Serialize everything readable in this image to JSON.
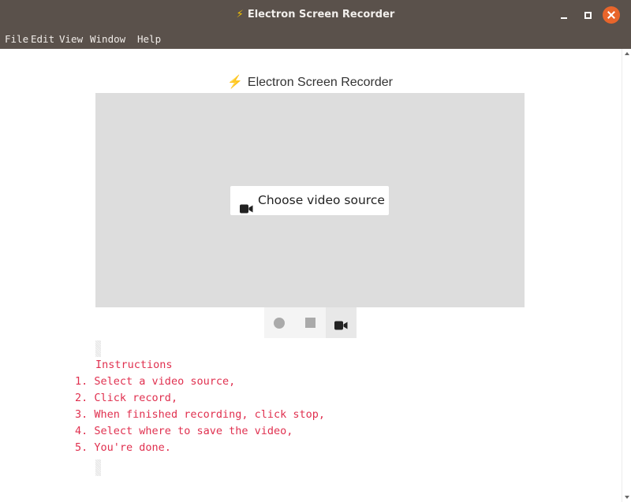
{
  "window": {
    "title": "Electron Screen Recorder",
    "title_icon": "⚡",
    "buttons": [
      "minimize",
      "maximize",
      "close"
    ]
  },
  "menu": [
    "File",
    "Edit",
    "View",
    "Window",
    "Help"
  ],
  "app": {
    "heading_icon": "⚡",
    "heading": "Electron Screen Recorder",
    "choose_source_label": "Choose video source",
    "controls": {
      "record_icon": "record-icon",
      "stop_icon": "stop-icon",
      "camera_icon": "video-camera-icon"
    }
  },
  "instructions": {
    "title": "Instructions",
    "steps": [
      {
        "num": "1.",
        "text": "Select a video source,"
      },
      {
        "num": "2.",
        "text": "Click record,"
      },
      {
        "num": "3.",
        "text": "When finished recording, click stop,"
      },
      {
        "num": "4.",
        "text": "Select where to save the video,"
      },
      {
        "num": "5.",
        "text": "You're done."
      }
    ]
  },
  "colors": {
    "titlebar": "#5a514b",
    "close_button": "#e8652b",
    "instructions_text": "#e0304f",
    "video_area": "#dddddd"
  }
}
